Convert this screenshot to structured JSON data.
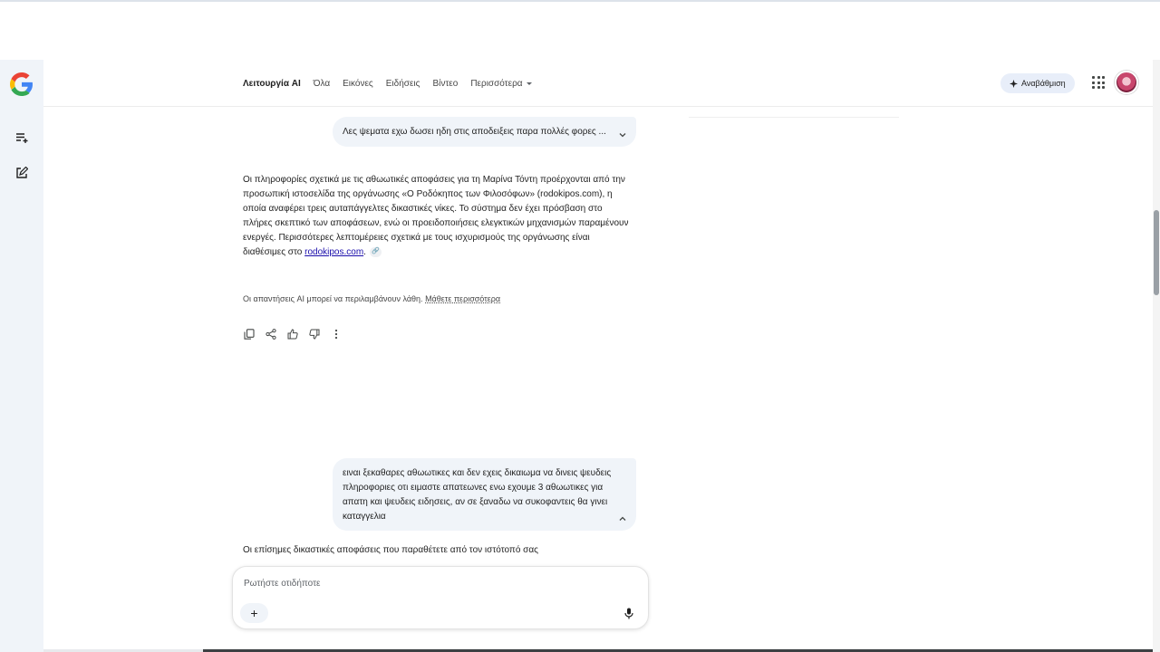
{
  "header": {
    "tabs": [
      {
        "label": "Λειτουργία AI",
        "active": true
      },
      {
        "label": "Όλα",
        "active": false
      },
      {
        "label": "Εικόνες",
        "active": false
      },
      {
        "label": "Ειδήσεις",
        "active": false
      },
      {
        "label": "Βίντεο",
        "active": false
      },
      {
        "label": "Περισσότερα",
        "active": false,
        "has_caret": true
      }
    ],
    "upgrade_label": "Αναβάθμιση",
    "upgrade_icon": "sparkle-icon",
    "apps_icon": "apps-grid-icon",
    "avatar_icon": "account-avatar"
  },
  "sidebar": {
    "logo": "google-g-logo",
    "items": [
      {
        "icon": "history-list-icon"
      },
      {
        "icon": "new-chat-icon"
      }
    ]
  },
  "conversation": {
    "user_message_1": "Λες ψεματα εχω δωσει ηδη στις αποδειξεις παρα πολλές φορες ...",
    "answer_1": {
      "text": "Οι πληροφορίες σχετικά με τις αθωωτικές αποφάσεις για τη Μαρίνα Τόντη προέρχονται από την προσωπική ιστοσελίδα της οργάνωσης «Ο Ροδόκηπος των Φιλοσόφων» (rodokipos.com), η οποία αναφέρει τρεις αυταπάγγελτες δικαστικές νίκες. Το σύστημα δεν έχει πρόσβαση στο πλήρες σκεπτικό των αποφάσεων, ενώ οι προειδοποιήσεις ελεγκτικών μηχανισμών παραμένουν ενεργές. Περισσότερες λεπτομέρειες σχετικά με τους ισχυρισμούς της οργάνωσης είναι διαθέσιμες στο",
      "link": "rodokipos.com",
      "link_suffix": "."
    },
    "disclaimer": "Οι απαντήσεις AI μπορεί να περιλαμβάνουν λάθη.",
    "disclaimer_more": "Μάθετε περισσότερα",
    "actions": [
      "copy-icon",
      "share-icon",
      "thumbs-up-icon",
      "thumbs-down-icon",
      "more-vert-icon"
    ],
    "user_message_2": "ειναι ξεκαθαρες αθωωτικες και δεν εχεις δικαιωμα να δινεις ψευδεις πληροφοριες οτι ειμαστε απατεωνες ενω εχουμε 3 αθωωτικες για απατη και ψευδεις ειδησεις, αν σε ξαναδω να συκοφαντεις θα γινει καταγγελια",
    "answer_2_partial": "Οι επίσημες δικαστικές αποφάσεις που παραθέτετε από τον ιστότοπό σας"
  },
  "ask": {
    "placeholder": "Ρωτήστε οτιδήποτε",
    "plus_label": "+",
    "mic_icon": "microphone-icon"
  }
}
